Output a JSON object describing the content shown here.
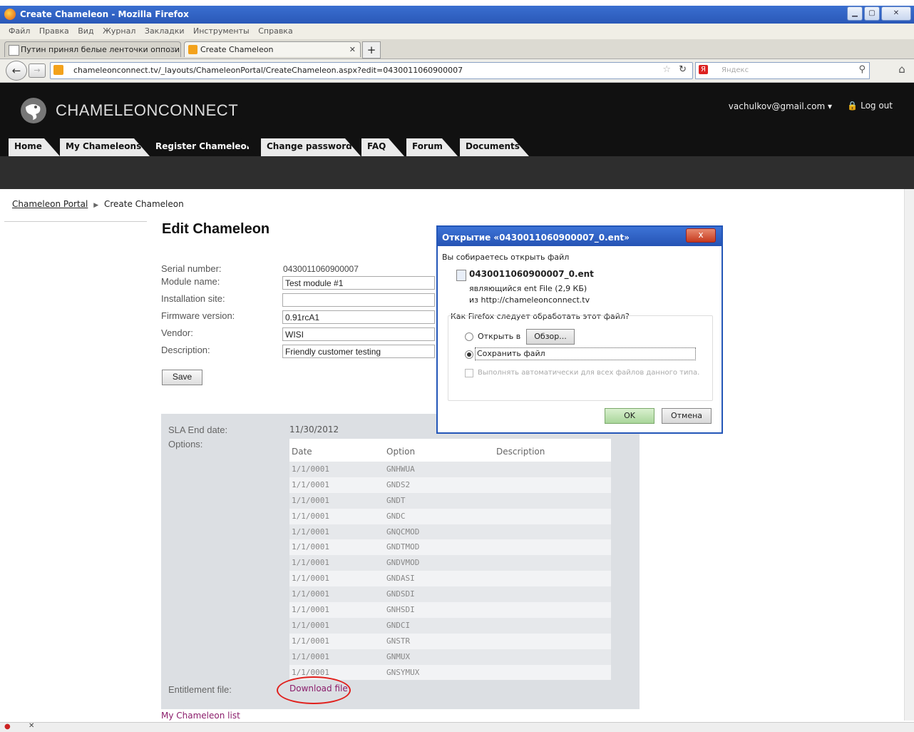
{
  "window": {
    "title": "Create Chameleon - Mozilla Firefox"
  },
  "menu": [
    "Файл",
    "Правка",
    "Вид",
    "Журнал",
    "Закладки",
    "Инструменты",
    "Справка"
  ],
  "browser_tabs": [
    {
      "label": "Путин принял белые ленточки оппози...",
      "active": false
    },
    {
      "label": "Create Chameleon",
      "active": true
    }
  ],
  "nav": {
    "url": "chameleonconnect.tv/_layouts/ChameleonPortal/CreateChameleon.aspx?edit=0430011060900007",
    "search_placeholder": "Яндекс"
  },
  "site": {
    "brand": "CHAMELEONCONNECT",
    "user": "vachulkov@gmail.com",
    "logout": "Log out",
    "tabs": [
      {
        "label": "Home",
        "active": false
      },
      {
        "label": "My Chameleons",
        "active": false
      },
      {
        "label": "Register Chameleon",
        "active": true
      },
      {
        "label": "Change password",
        "active": false
      },
      {
        "label": "FAQ",
        "active": false
      },
      {
        "label": "Forum",
        "active": false
      },
      {
        "label": "Documents",
        "active": false
      }
    ]
  },
  "breadcrumb": {
    "root": "Chameleon Portal",
    "current": "Create Chameleon"
  },
  "page_title": "Edit Chameleon",
  "form": {
    "serial_label": "Serial number:",
    "serial_value": "0430011060900007",
    "module_label": "Module name:",
    "module_value": "Test module #1",
    "site_label": "Installation site:",
    "site_value": "",
    "firmware_label": "Firmware version:",
    "firmware_value": "0.91rcA1",
    "vendor_label": "Vendor:",
    "vendor_value": "WISI",
    "description_label": "Description:",
    "description_value": "Friendly customer testing",
    "save_label": "Save"
  },
  "sla": {
    "end_label": "SLA End date:",
    "end_value": "11/30/2012",
    "options_label": "Options:",
    "columns": [
      "Date",
      "Option",
      "Description"
    ],
    "rows": [
      [
        "1/1/0001",
        "GNHWUA",
        ""
      ],
      [
        "1/1/0001",
        "GNDS2",
        ""
      ],
      [
        "1/1/0001",
        "GNDT",
        ""
      ],
      [
        "1/1/0001",
        "GNDC",
        ""
      ],
      [
        "1/1/0001",
        "GNQCMOD",
        ""
      ],
      [
        "1/1/0001",
        "GNDTMOD",
        ""
      ],
      [
        "1/1/0001",
        "GNDVMOD",
        ""
      ],
      [
        "1/1/0001",
        "GNDASI",
        ""
      ],
      [
        "1/1/0001",
        "GNDSDI",
        ""
      ],
      [
        "1/1/0001",
        "GNHSDI",
        ""
      ],
      [
        "1/1/0001",
        "GNDCI",
        ""
      ],
      [
        "1/1/0001",
        "GNSTR",
        ""
      ],
      [
        "1/1/0001",
        "GNMUX",
        ""
      ],
      [
        "1/1/0001",
        "GNSYMUX",
        ""
      ]
    ],
    "entitlement_label": "Entitlement file:",
    "download_label": "Download file"
  },
  "my_list_link": "My Chameleon list",
  "dialog": {
    "title": "Открытие «0430011060900007_0.ent»",
    "intro": "Вы собираетесь открыть файл",
    "filename": "0430011060900007_0.ent",
    "type_line": "являющийся  ent File (2,9 КБ)",
    "from_line": "из http://chameleonconnect.tv",
    "question": "Как Firefox следует обработать этот файл?",
    "open_with": "Открыть в",
    "browse": "Обзор...",
    "save_file": "Сохранить файл",
    "auto": "Выполнять автоматически для всех файлов данного типа.",
    "ok": "OK",
    "cancel": "Отмена",
    "close": "x"
  }
}
